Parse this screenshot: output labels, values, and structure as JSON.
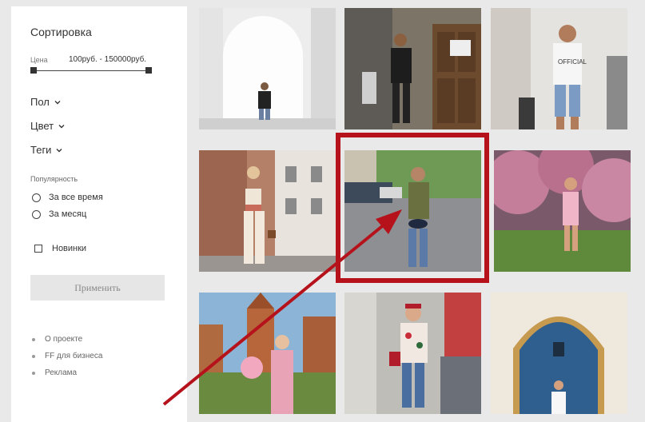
{
  "sidebar": {
    "sort_title": "Сортировка",
    "price_label": "Цена",
    "price_range": "100руб. - 150000руб.",
    "filters": [
      {
        "label": "Пол",
        "icon": "chevron-down-icon"
      },
      {
        "label": "Цвет",
        "icon": "chevron-down-icon"
      },
      {
        "label": "Теги",
        "icon": "chevron-down-icon"
      }
    ],
    "popularity_title": "Популярность",
    "popularity_options": [
      {
        "label": "За все время",
        "selected": false
      },
      {
        "label": "За месяц",
        "selected": false
      }
    ],
    "new_checkbox_label": "Новинки",
    "new_checkbox_checked": false,
    "apply_button": "Применить",
    "footer_links": [
      "О проекте",
      "FF для бизнеса",
      "Реклама"
    ]
  },
  "gallery": {
    "photos": [
      {
        "subject": "man-white-arch"
      },
      {
        "subject": "man-wooden-door"
      },
      {
        "subject": "man-official-tee"
      },
      {
        "subject": "woman-street-building"
      },
      {
        "subject": "woman-city-street",
        "highlighted": true
      },
      {
        "subject": "woman-blossom-trees"
      },
      {
        "subject": "woman-pink-dress-castle"
      },
      {
        "subject": "woman-floral-jacket-crowd"
      },
      {
        "subject": "woman-blue-archway"
      }
    ],
    "highlight_color": "#b5121b",
    "arrow_color": "#b5121b"
  }
}
